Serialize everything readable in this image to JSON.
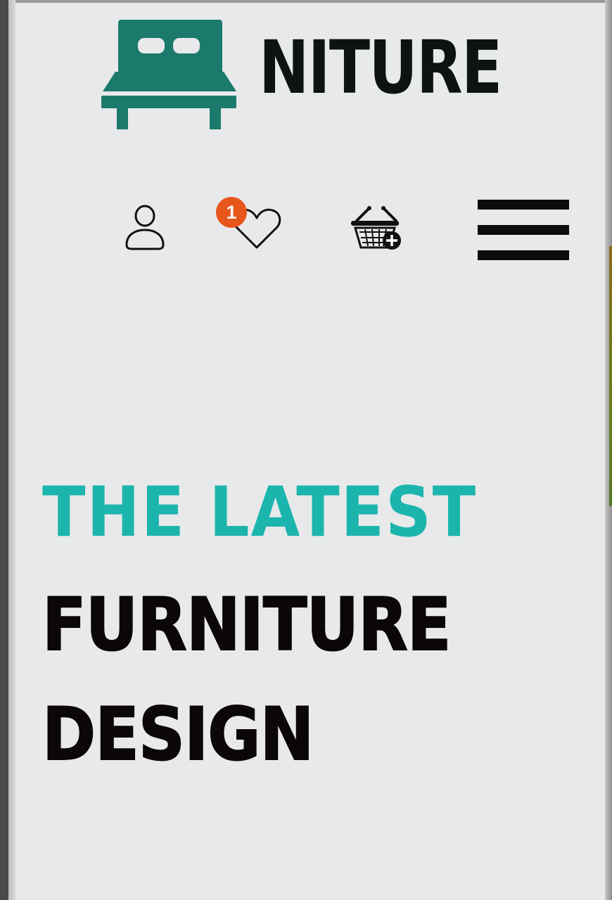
{
  "brand": {
    "logo_text": "NITURE",
    "logo_icon": "bed-icon",
    "logo_color": "#1c7a6c"
  },
  "header_icons": {
    "account": "user-icon",
    "wishlist": "heart-icon",
    "wishlist_count": "1",
    "basket": "basket-add-icon",
    "menu": "hamburger-menu-icon",
    "badge_color": "#e8561b"
  },
  "hero": {
    "accent_line": "THE LATEST",
    "line_1": "FURNITURE",
    "line_2": "DESIGN",
    "accent_color": "#1bb5ad",
    "text_color": "#0b0607"
  }
}
